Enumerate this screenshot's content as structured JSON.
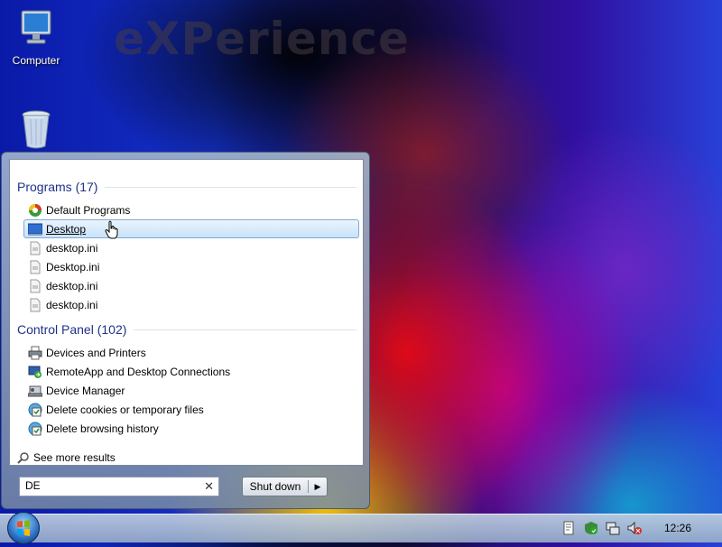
{
  "wallpaper": {
    "brand_text": "eXPerience"
  },
  "desktop": {
    "icons": [
      {
        "label": "Computer",
        "icon": "computer-icon"
      },
      {
        "label": "",
        "icon": "recycle-bin-icon"
      }
    ]
  },
  "start_menu": {
    "groups": [
      {
        "title": "Programs (17)",
        "items": [
          {
            "label": "Default Programs",
            "icon": "default-programs-icon"
          },
          {
            "label": "Desktop",
            "icon": "desktop-shortcut-icon",
            "selected": true
          },
          {
            "label": "desktop.ini",
            "icon": "ini-file-icon"
          },
          {
            "label": "Desktop.ini",
            "icon": "ini-file-icon"
          },
          {
            "label": "desktop.ini",
            "icon": "ini-file-icon"
          },
          {
            "label": "desktop.ini",
            "icon": "ini-file-icon"
          }
        ]
      },
      {
        "title": "Control Panel (102)",
        "items": [
          {
            "label": "Devices and Printers",
            "icon": "printer-icon"
          },
          {
            "label": "RemoteApp and Desktop Connections",
            "icon": "remoteapp-icon"
          },
          {
            "label": "Device Manager",
            "icon": "device-manager-icon"
          },
          {
            "label": "Delete cookies or temporary files",
            "icon": "internet-options-icon"
          },
          {
            "label": "Delete browsing history",
            "icon": "internet-options-icon"
          }
        ]
      }
    ],
    "see_more": "See more results",
    "search": {
      "value": "DE"
    },
    "shutdown_label": "Shut down"
  },
  "taskbar": {
    "clock": "12:26",
    "tray_icons": [
      "action-center-icon",
      "security-icon",
      "network-icon",
      "volume-muted-icon"
    ]
  },
  "colors": {
    "group_heading": "#1e3287",
    "selection": "#c9e2f8"
  }
}
